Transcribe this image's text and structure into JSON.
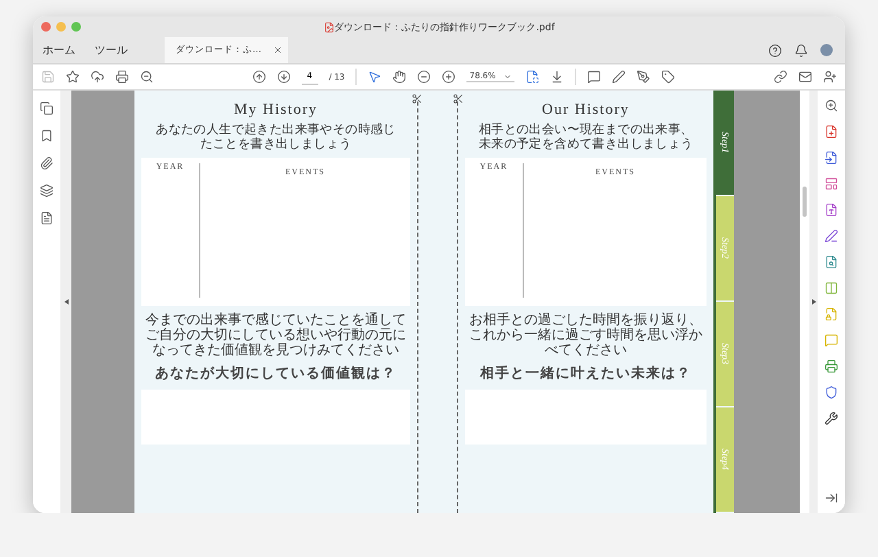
{
  "window": {
    "title": "ダウンロード：ふたりの指針作りワークブック.pdf"
  },
  "nav_tabs": [
    {
      "label": "ホーム",
      "selected": false
    },
    {
      "label": "ツール",
      "selected": false
    }
  ],
  "document_tab": {
    "label": "ダウンロード：ふ…",
    "selected": true
  },
  "toolbar": {
    "page": "4",
    "page_total": "/ 13",
    "zoom": "78.6%"
  },
  "pages": [
    {
      "title": "My History",
      "subtitle": "あなたの人生で起きた出来事やその時感じたことを書き出しましょう",
      "columns": [
        "YEAR",
        "EVENTS"
      ],
      "prompt": [
        "今までの出来事で感じていたことを通して",
        "ご自分の大切にしている想いや行動の元になってきた価値観を見つけみてください"
      ],
      "question": "あなたが大切にしている価値観は？"
    },
    {
      "title": "Our History",
      "subtitle": "相手との出会い〜現在までの出来事、未来の予定を含めて書き出しましょう",
      "columns": [
        "YEAR",
        "EVENTS"
      ],
      "prompt": [
        "お相手との過ごした時間を振り返り、",
        "これから一緒に過ごす時間を思い浮かべてください"
      ],
      "question": "相手と一緒に叶えたい未来は？"
    }
  ],
  "step_tabs": [
    {
      "label": "Step1",
      "selected": true
    },
    {
      "label": "Step2",
      "selected": false
    },
    {
      "label": "Step3",
      "selected": false
    },
    {
      "label": "Step4",
      "selected": false
    }
  ]
}
